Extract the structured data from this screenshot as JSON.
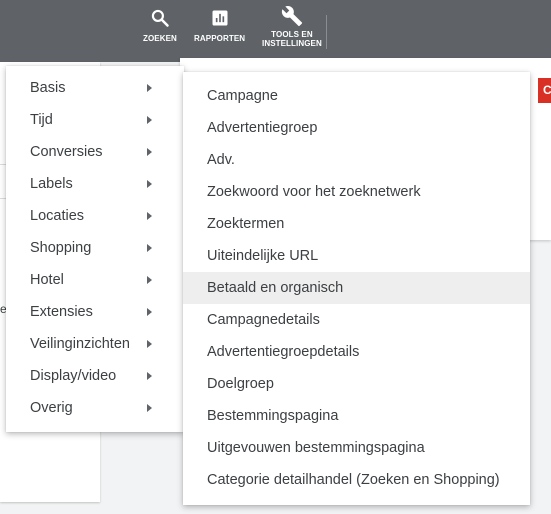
{
  "toolbar": {
    "search_label": "ZOEKEN",
    "reports_label": "RAPPORTEN",
    "tools_label": "TOOLS EN\nINSTELLINGEN"
  },
  "background": {
    "fragment_text": "e",
    "red_tab_text": "C"
  },
  "segment_menu": {
    "items": [
      {
        "label": "Basis"
      },
      {
        "label": "Tijd"
      },
      {
        "label": "Conversies"
      },
      {
        "label": "Labels"
      },
      {
        "label": "Locaties"
      },
      {
        "label": "Shopping"
      },
      {
        "label": "Hotel"
      },
      {
        "label": "Extensies"
      },
      {
        "label": "Veilinginzichten"
      },
      {
        "label": "Display/video"
      },
      {
        "label": "Overig"
      }
    ]
  },
  "submenu": {
    "highlighted_index": 6,
    "items": [
      {
        "label": "Campagne"
      },
      {
        "label": "Advertentiegroep"
      },
      {
        "label": "Adv."
      },
      {
        "label": "Zoekwoord voor het zoeknetwerk"
      },
      {
        "label": "Zoektermen"
      },
      {
        "label": "Uiteindelijke URL"
      },
      {
        "label": "Betaald en organisch"
      },
      {
        "label": "Campagnedetails"
      },
      {
        "label": "Advertentiegroepdetails"
      },
      {
        "label": "Doelgroep"
      },
      {
        "label": "Bestemmingspagina"
      },
      {
        "label": "Uitgevouwen bestemmingspagina"
      },
      {
        "label": "Categorie detailhandel (Zoeken en Shopping)"
      }
    ]
  },
  "colors": {
    "topbar": "#5f6368",
    "highlight": "#eeeeee",
    "text": "#3c4043",
    "accent_red": "#d93025"
  }
}
